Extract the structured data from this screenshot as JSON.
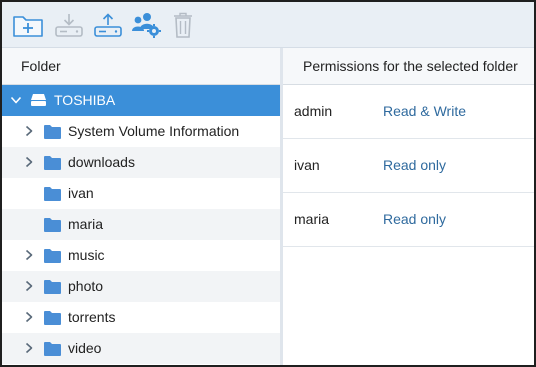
{
  "toolbar": {
    "buttons": [
      {
        "name": "new-folder-icon",
        "enabled": true
      },
      {
        "name": "download-icon",
        "enabled": false
      },
      {
        "name": "upload-icon",
        "enabled": true
      },
      {
        "name": "users-settings-icon",
        "enabled": true
      },
      {
        "name": "trash-icon",
        "enabled": false
      }
    ]
  },
  "colors": {
    "accent": "#3b8fd9",
    "folder": "#4a8ed6",
    "link": "#2f6a9e",
    "toolbar_bg": "#e9eff5"
  },
  "left": {
    "header": "Folder",
    "drive": {
      "label": "TOSHIBA",
      "icon": "drive-icon",
      "expanded": true
    },
    "folders": [
      {
        "label": "System Volume Information",
        "has_children": true
      },
      {
        "label": "downloads",
        "has_children": true
      },
      {
        "label": "ivan",
        "has_children": false
      },
      {
        "label": "maria",
        "has_children": false
      },
      {
        "label": "music",
        "has_children": true
      },
      {
        "label": "photo",
        "has_children": true
      },
      {
        "label": "torrents",
        "has_children": true
      },
      {
        "label": "video",
        "has_children": true
      }
    ]
  },
  "right": {
    "header": "Permissions for the selected folder",
    "permissions": [
      {
        "user": "admin",
        "access": "Read & Write"
      },
      {
        "user": "ivan",
        "access": "Read only"
      },
      {
        "user": "maria",
        "access": "Read only"
      }
    ]
  }
}
